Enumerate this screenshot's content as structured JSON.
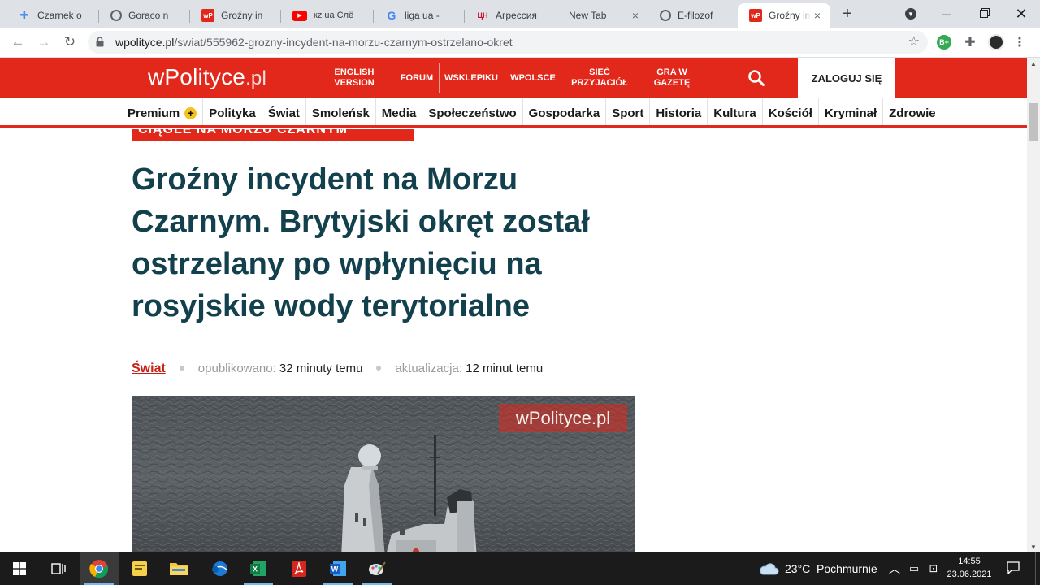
{
  "browser": {
    "tabs": [
      {
        "title": "Czarnek o",
        "icon": "puzzle-icon",
        "color": "#4b8bf4"
      },
      {
        "title": "Gorąco n",
        "icon": "globe-icon",
        "color": "#5f6368"
      },
      {
        "title": "Groźny in",
        "icon": "wpolityce-icon",
        "color": "#e2281b"
      },
      {
        "title": "кz ua Cлё",
        "icon": "youtube-icon",
        "color": "#ff0000"
      },
      {
        "title": "liga ua -",
        "icon": "google-icon",
        "color": "#4285f4"
      },
      {
        "title": "Агрессия",
        "icon": "tsn-icon",
        "color": "#c8102e"
      },
      {
        "title": "New Tab",
        "icon": "none",
        "color": "#5f6368"
      },
      {
        "title": "E-filozof",
        "icon": "globe-icon",
        "color": "#5f6368"
      },
      {
        "title": "Groźny in",
        "icon": "wpolityce-icon",
        "color": "#e2281b",
        "active": true
      }
    ],
    "url_host": "wpolityce.pl",
    "url_path": "/swiat/555962-grozny-incydent-na-morzu-czarnym-ostrzelano-okret"
  },
  "site": {
    "logo_main": "wPolityce",
    "logo_suffix": ".pl",
    "topnav": [
      {
        "label": "ENGLISH\nVERSION"
      },
      {
        "label": "FORUM"
      },
      {
        "label": "WSKLEPIKU"
      },
      {
        "label": "WPOLSCE"
      },
      {
        "label": "SIEĆ\nPRZYJACIÓŁ"
      },
      {
        "label": "GRA W\nGAZETĘ"
      }
    ],
    "login_label": "ZALOGUJ SIĘ",
    "categories": [
      "Premium",
      "Polityka",
      "Świat",
      "Smoleńsk",
      "Media",
      "Społeczeństwo",
      "Gospodarka",
      "Sport",
      "Historia",
      "Kultura",
      "Kościół",
      "Kryminał",
      "Zdrowie"
    ],
    "accent_color": "#e2281b"
  },
  "article": {
    "kicker": "CIĄGLE NA MORZU CZARNYM",
    "headline": "Groźny incydent na Morzu Czarnym. Brytyjski okręt został ostrzelany po wpłynięciu na rosyjskie wody terytorialne",
    "section": "Świat",
    "published_label": "opublikowano:",
    "published_value": "32 minuty temu",
    "updated_label": "aktualizacja:",
    "updated_value": "12 minut temu",
    "photo_watermark": "wPolityce.pl"
  },
  "taskbar": {
    "weather_temp": "23°C",
    "weather_desc": "Pochmurnie",
    "time": "14:55",
    "date": "23.06.2021"
  }
}
